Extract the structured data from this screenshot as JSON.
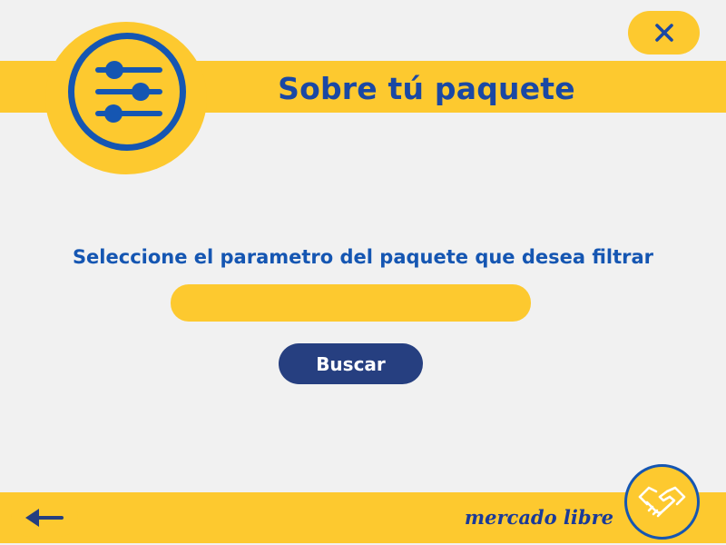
{
  "header": {
    "title": "Sobre tú paquete",
    "badge_icon": "sliders-icon",
    "close_icon": "close-icon"
  },
  "main": {
    "instruction": "Seleccione el parametro del paquete que desea filtrar",
    "filter_input": {
      "value": "",
      "placeholder": ""
    },
    "search_label": "Buscar"
  },
  "footer": {
    "back_icon": "arrow-left-icon",
    "brand": "mercado libre",
    "logo_icon": "handshake-icon"
  },
  "colors": {
    "background": "#f1f1f1",
    "accent_yellow": "#fdc92f",
    "primary_blue": "#1556b2",
    "button_navy": "#263f80"
  }
}
